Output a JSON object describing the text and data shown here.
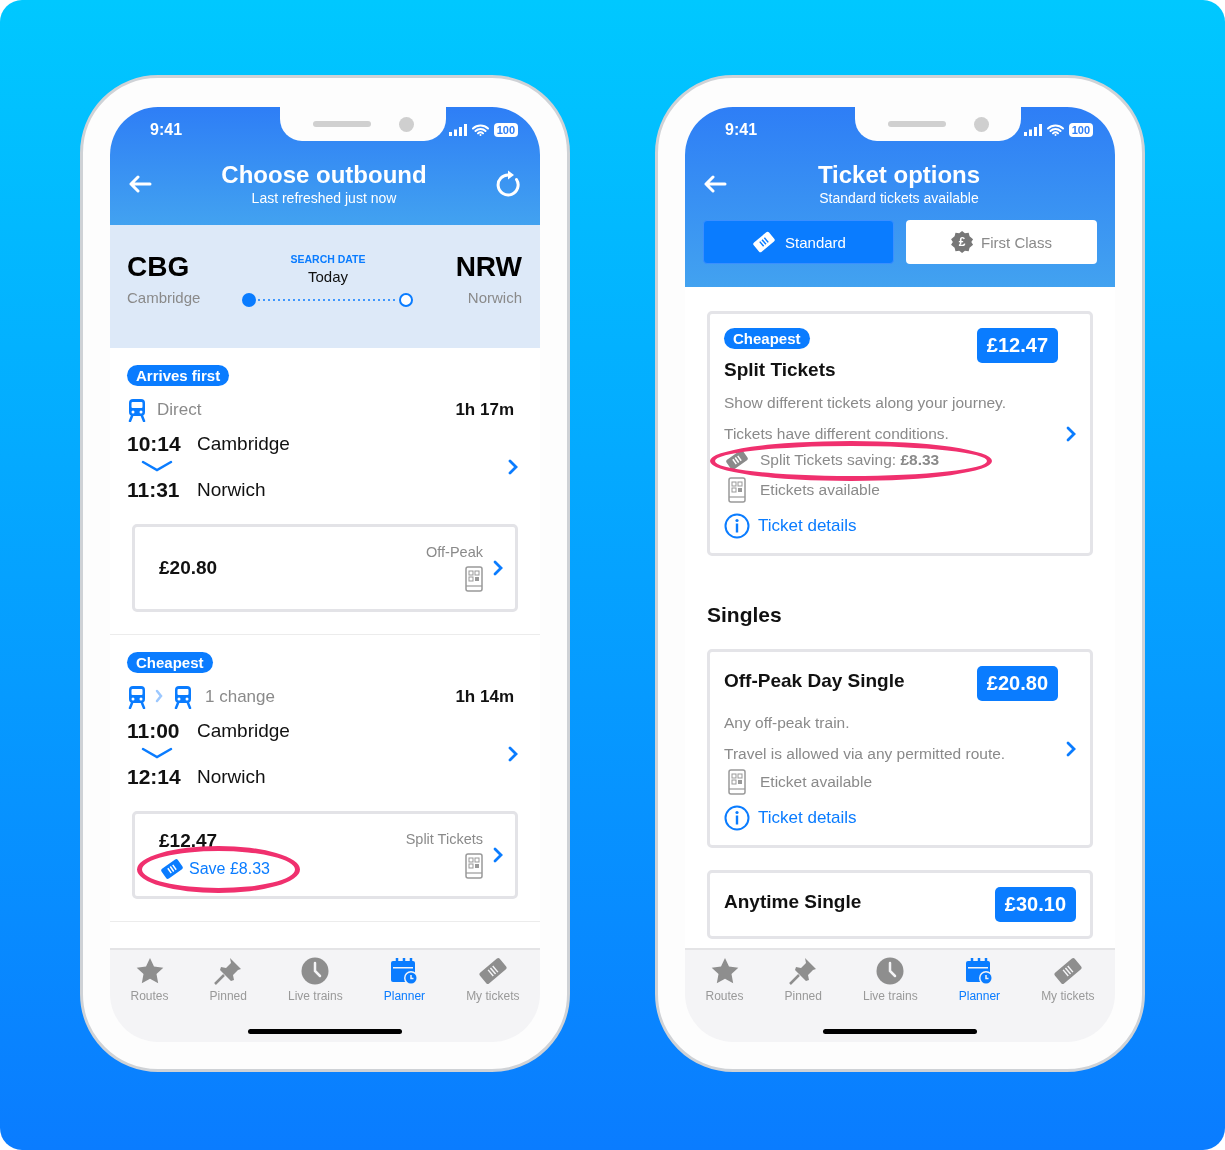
{
  "phones": [
    {
      "kind": "journeys",
      "status": {
        "time": "9:41",
        "battery": "100"
      },
      "header": {
        "title": "Choose outbound",
        "subtitle": "Last refreshed just now"
      },
      "search": {
        "from_code": "CBG",
        "from_name": "Cambridge",
        "label": "SEARCH DATE",
        "date": "Today",
        "to_code": "NRW",
        "to_name": "Norwich"
      },
      "journeys": [
        {
          "badge": "Arrives first",
          "kind": "direct",
          "changes": "Direct",
          "duration": "1h 17m",
          "depart": {
            "time": "10:14",
            "station": "Cambridge"
          },
          "arrive": {
            "time": "11:31",
            "station": "Norwich"
          },
          "fare": {
            "price": "£20.80",
            "type": "Off-Peak"
          }
        },
        {
          "badge": "Cheapest",
          "kind": "change",
          "changes": "1 change",
          "duration": "1h 14m",
          "depart": {
            "time": "11:00",
            "station": "Cambridge"
          },
          "arrive": {
            "time": "12:14",
            "station": "Norwich"
          },
          "fare": {
            "price": "£12.47",
            "type": "Split Tickets",
            "saving": {
              "text": "Save £8.33",
              "highlighted": true
            }
          }
        }
      ],
      "tabbar": [
        {
          "kind": "star",
          "label": "Routes",
          "selected": false
        },
        {
          "kind": "pin",
          "label": "Pinned",
          "selected": false
        },
        {
          "kind": "clock",
          "label": "Live trains",
          "selected": false
        },
        {
          "kind": "calendar",
          "label": "Planner",
          "selected": true
        },
        {
          "kind": "ticket",
          "label": "My tickets",
          "selected": false
        }
      ]
    },
    {
      "kind": "tickets",
      "status": {
        "time": "9:41",
        "battery": "100"
      },
      "header": {
        "title": "Ticket options",
        "subtitle": "Standard tickets available"
      },
      "segments": [
        {
          "kind": "ticket",
          "label": "Standard",
          "selected": true
        },
        {
          "kind": "pound",
          "icon_text": "£",
          "label": "First Class",
          "selected": false
        }
      ],
      "cards": [
        {
          "badge": "Cheapest",
          "title": "Split Tickets",
          "price": "£12.47",
          "lines": [
            "Show different tickets along your journey.",
            "Tickets have different conditions."
          ],
          "features": [
            {
              "kind": "saving",
              "text": "Split Tickets saving: **£8.33**",
              "highlighted": true
            },
            {
              "kind": "eticket",
              "text": "Etickets available",
              "highlighted": false
            }
          ],
          "link": "Ticket details"
        },
        {
          "heading": "Singles",
          "title": "Off-Peak Day Single",
          "price": "£20.80",
          "lines": [
            "Any off-peak train.",
            "Travel is allowed via any permitted route."
          ],
          "features": [
            {
              "kind": "eticket",
              "text": "Eticket available",
              "highlighted": false
            }
          ],
          "link": "Ticket details"
        },
        {
          "title": "Anytime Single",
          "price": "£30.10"
        }
      ],
      "tabbar": [
        {
          "kind": "star",
          "label": "Routes",
          "selected": false
        },
        {
          "kind": "pin",
          "label": "Pinned",
          "selected": false
        },
        {
          "kind": "clock",
          "label": "Live trains",
          "selected": false
        },
        {
          "kind": "calendar",
          "label": "Planner",
          "selected": true
        },
        {
          "kind": "ticket",
          "label": "My tickets",
          "selected": false
        }
      ]
    }
  ]
}
